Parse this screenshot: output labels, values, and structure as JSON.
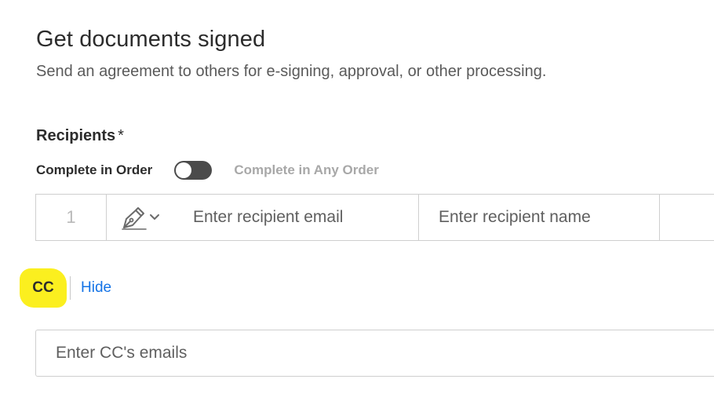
{
  "header": {
    "title": "Get documents signed",
    "subtitle": "Send an agreement to others for e-signing, approval, or other processing."
  },
  "recipients": {
    "label": "Recipients",
    "required_marker": "*",
    "order": {
      "in_order_label": "Complete in Order",
      "any_order_label": "Complete in Any Order",
      "toggle_on": false
    },
    "rows": [
      {
        "index": "1",
        "role_icon": "pen-signer-icon",
        "email_placeholder": "Enter recipient email",
        "name_placeholder": "Enter recipient name"
      }
    ]
  },
  "cc": {
    "label": "CC",
    "hide_label": "Hide",
    "placeholder": "Enter CC's emails",
    "highlight_color": "#fbef1f"
  },
  "colors": {
    "link": "#1473e6",
    "toggle_track": "#4b4b4b"
  }
}
